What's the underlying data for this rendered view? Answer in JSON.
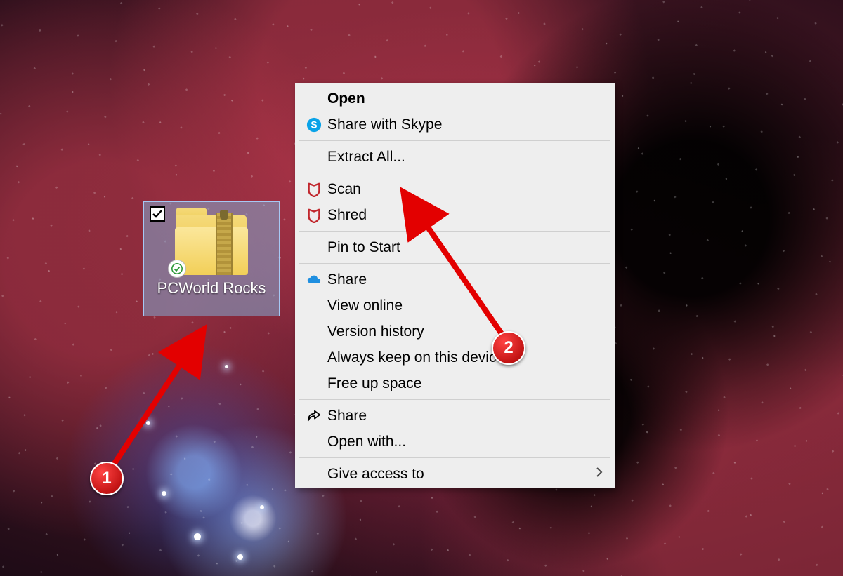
{
  "desktop": {
    "item_label": "PCWorld Rocks",
    "item_selected": true
  },
  "context_menu": {
    "items": [
      {
        "id": "open",
        "label": "Open",
        "bold": true,
        "icon": null
      },
      {
        "id": "share-skype",
        "label": "Share with Skype",
        "icon": "skype"
      },
      {
        "sep": true
      },
      {
        "id": "extract-all",
        "label": "Extract All...",
        "icon": null
      },
      {
        "sep": true
      },
      {
        "id": "mcafee-scan",
        "label": "Scan",
        "icon": "mcafee"
      },
      {
        "id": "mcafee-shred",
        "label": "Shred",
        "icon": "mcafee"
      },
      {
        "sep": true
      },
      {
        "id": "pin-start",
        "label": "Pin to Start",
        "icon": null
      },
      {
        "sep": true
      },
      {
        "id": "onedrive-share",
        "label": "Share",
        "icon": "onedrive"
      },
      {
        "id": "view-online",
        "label": "View online",
        "icon": null
      },
      {
        "id": "version-history",
        "label": "Version history",
        "icon": null
      },
      {
        "id": "keep-device",
        "label": "Always keep on this device",
        "icon": null
      },
      {
        "id": "free-space",
        "label": "Free up space",
        "icon": null
      },
      {
        "sep": true
      },
      {
        "id": "share",
        "label": "Share",
        "icon": "share-arrow"
      },
      {
        "id": "open-with",
        "label": "Open with...",
        "icon": null
      },
      {
        "sep": true
      },
      {
        "id": "give-access",
        "label": "Give access to",
        "icon": null,
        "submenu": true
      }
    ]
  },
  "annotations": {
    "badge1": "1",
    "badge2": "2"
  }
}
